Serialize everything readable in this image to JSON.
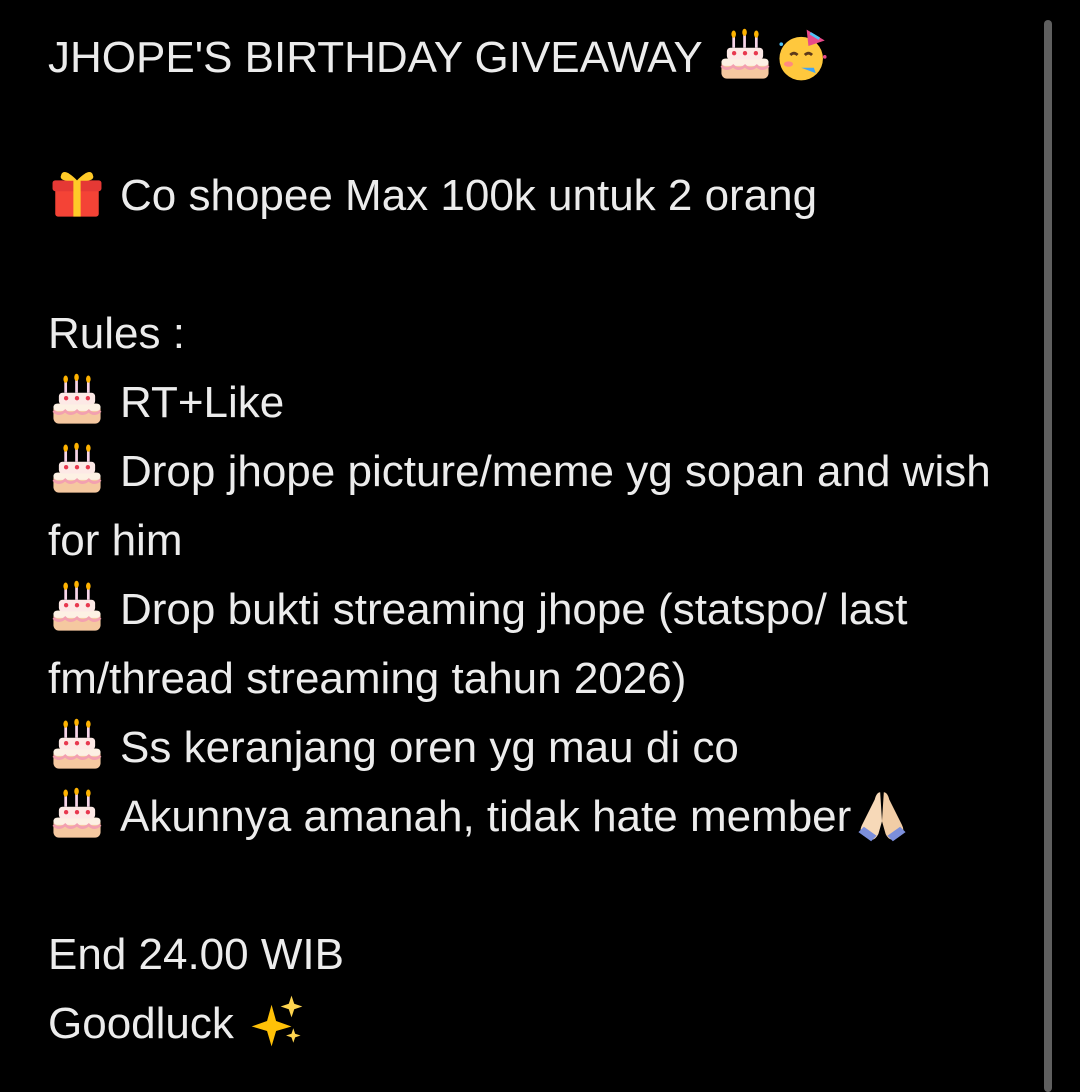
{
  "note": {
    "title": "JHOPE'S BIRTHDAY GIVEAWAY",
    "prize": "Co shopee Max 100k untuk 2 orang",
    "rules_heading": "Rules :",
    "rules": [
      "RT+Like",
      "Drop jhope picture/meme yg sopan and wish for him",
      "Drop bukti streaming jhope (statspo/ last fm/thread streaming tahun 2026)",
      "Ss keranjang oren yg mau di co",
      "Akunnya amanah, tidak hate member"
    ],
    "end_time": "End 24.00 WIB",
    "closing": "Goodluck"
  },
  "icons": {
    "title_icons": [
      "birthday-cake-icon",
      "partying-face-icon"
    ],
    "prize_icon": "gift-icon",
    "rule_icon": "birthday-cake-icon",
    "rule5_trailing_icon": "folded-hands-icon",
    "closing_icon": "sparkles-icon"
  },
  "colors": {
    "background": "#000000",
    "text": "#ececec",
    "scrollbar": "#5f5f5f"
  }
}
